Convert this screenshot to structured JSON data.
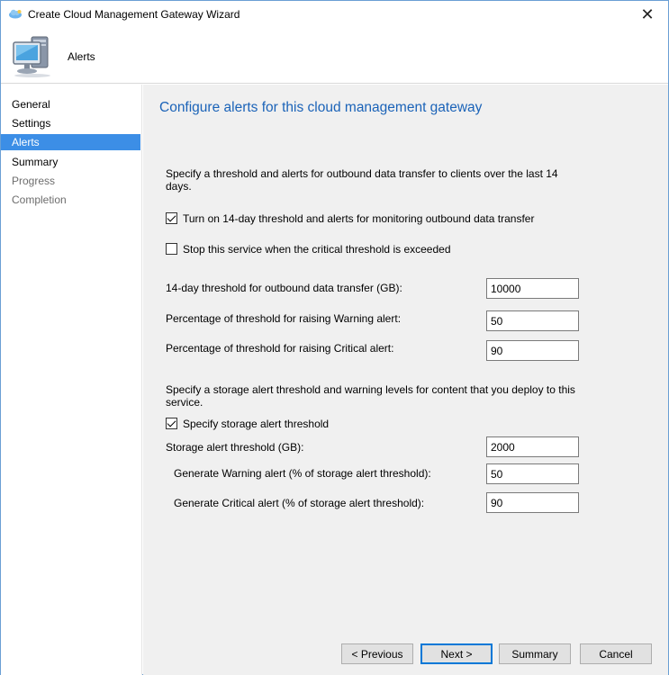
{
  "window": {
    "title": "Create Cloud Management Gateway Wizard",
    "close_symbol": "✕"
  },
  "header": {
    "title": "Alerts",
    "icon": "computer-monitor-icon"
  },
  "sidebar": {
    "items": [
      {
        "label": "General",
        "state": "normal"
      },
      {
        "label": "Settings",
        "state": "normal"
      },
      {
        "label": "Alerts",
        "state": "active"
      },
      {
        "label": "Summary",
        "state": "normal"
      },
      {
        "label": "Progress",
        "state": "disabled"
      },
      {
        "label": "Completion",
        "state": "disabled"
      }
    ]
  },
  "main": {
    "title": "Configure alerts for this cloud management gateway",
    "outbound_description": "Specify a threshold and alerts for outbound data transfer to clients over the last 14 days.",
    "turn_on_threshold": {
      "label": "Turn on 14-day threshold and alerts for monitoring outbound data transfer",
      "checked": true
    },
    "stop_service": {
      "label": "Stop this service when the critical threshold is exceeded",
      "checked": false
    },
    "outbound_threshold": {
      "label": "14-day threshold for outbound data transfer (GB):",
      "value": "10000"
    },
    "warning_percent": {
      "label": "Percentage of threshold for raising Warning alert:",
      "value": "50"
    },
    "critical_percent": {
      "label": "Percentage of threshold for raising Critical alert:",
      "value": "90"
    },
    "storage_description": "Specify a storage alert threshold and warning levels for content that you deploy to this service.",
    "specify_storage": {
      "label": "Specify storage alert threshold",
      "checked": true
    },
    "storage_threshold": {
      "label": "Storage alert threshold (GB):",
      "value": "2000"
    },
    "storage_warning": {
      "label": "Generate Warning alert (% of storage alert threshold):",
      "value": "50"
    },
    "storage_critical": {
      "label": "Generate Critical alert (% of storage alert threshold):",
      "value": "90"
    }
  },
  "footer": {
    "previous_label": "< Previous",
    "next_label": "Next >",
    "summary_label": "Summary",
    "cancel_label": "Cancel"
  },
  "colors": {
    "accent": "#3c8ee6",
    "title_blue": "#1b63b8",
    "content_bg": "#f0f0f0"
  }
}
